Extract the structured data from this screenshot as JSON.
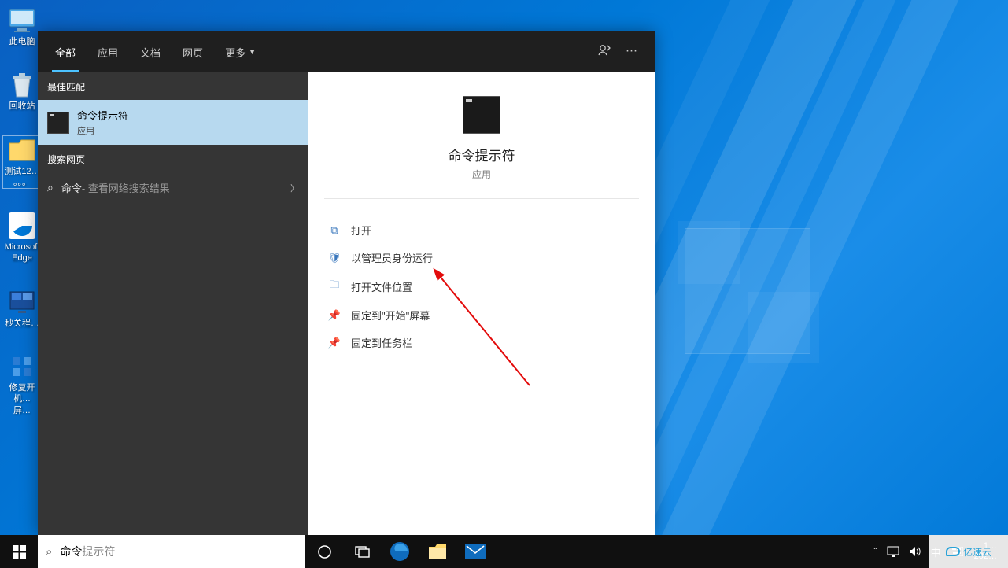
{
  "desktop_icons": [
    {
      "label": "此电脑",
      "id": "this-pc"
    },
    {
      "label": "回收站",
      "id": "recycle-bin"
    },
    {
      "label": "测试12…\n。。。",
      "id": "test-folder",
      "selected": true
    },
    {
      "label": "Microsoft\nEdge",
      "id": "edge"
    },
    {
      "label": "秒关程…",
      "id": "quick-shutdown"
    },
    {
      "label": "修复开机…\n屏…",
      "id": "repair-boot"
    }
  ],
  "search_panel": {
    "tabs": [
      {
        "label": "全部",
        "id": "all",
        "active": true
      },
      {
        "label": "应用",
        "id": "apps"
      },
      {
        "label": "文档",
        "id": "documents"
      },
      {
        "label": "网页",
        "id": "web"
      },
      {
        "label": "更多",
        "id": "more",
        "has_chevron": true
      }
    ],
    "left": {
      "best_match_header": "最佳匹配",
      "result": {
        "title": "命令提示符",
        "subtitle": "应用"
      },
      "web_header": "搜索网页",
      "web_item": {
        "query": "命令",
        "suffix": " - 查看网络搜索结果"
      }
    },
    "detail": {
      "title": "命令提示符",
      "subtitle": "应用",
      "actions": [
        {
          "icon": "open",
          "label": "打开"
        },
        {
          "icon": "admin",
          "label": "以管理员身份运行"
        },
        {
          "icon": "location",
          "label": "打开文件位置"
        },
        {
          "icon": "pin-start",
          "label": "固定到\"开始\"屏幕"
        },
        {
          "icon": "pin-taskbar",
          "label": "固定到任务栏"
        }
      ]
    }
  },
  "taskbar": {
    "search_typed": "命令",
    "search_placeholder": "提示符",
    "ime_lang": "中",
    "clock_time": "1…",
    "clock_date": "202…"
  },
  "watermark": "亿速云"
}
